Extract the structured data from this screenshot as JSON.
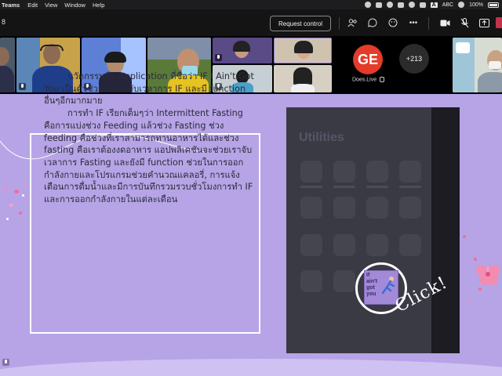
{
  "menubar": {
    "app": "Teams",
    "items": [
      "Edit",
      "View",
      "Window",
      "Help"
    ],
    "status_abc": "ABC",
    "battery_percent": "100%",
    "font_icon": "A"
  },
  "teams_bar": {
    "left_text": "8",
    "request_control_label": "Request control",
    "icons": [
      "people-icon",
      "chat-icon",
      "reactions-icon",
      "more-icon",
      "camera-icon",
      "mic-off-icon",
      "share-icon",
      "leave-icon"
    ]
  },
  "participants": {
    "guest_name": "Does.Live",
    "more_count": "+213"
  },
  "slide": {
    "paragraph1": "นวัตกรรมคือ Application ที่ชื่อว่า IF I Ain't Got You เป็นตัวช่วยในการจับเวลาการ IF และมี function อื่นๆอีกมากมาย",
    "paragraph2": "การทำ IF เรียกเต็มๆว่า Intermittent Fasting คือการแบ่งช่วง Feeding แล้วช่วง Fasting ช่วง feeding คือช่วงที่เราสามารถทานอาหารได้และช่วง fasting คือเราต้องงดอาหาร แอปพลิเคชันจะช่วยเราจับเวลาการ Fasting และยังมี function ช่วยในการออกกำลังกายและโปรแกรมช่วยคำนวณแคลอรี่,  การแจ้งเตือนการดื่มน้ำและมีการบันทึกรวมรวบชั่วโมงการทำ IF และการออกกำลังกายในแต่ละเดือน",
    "phone_folder_title": "Utilities",
    "app_logo_text": "If ain't got you",
    "click_text": "Click!"
  },
  "colors": {
    "slide_bg": "#b6a4e6",
    "teams_bg": "#141414",
    "guest_logo": "#e43b2a"
  }
}
